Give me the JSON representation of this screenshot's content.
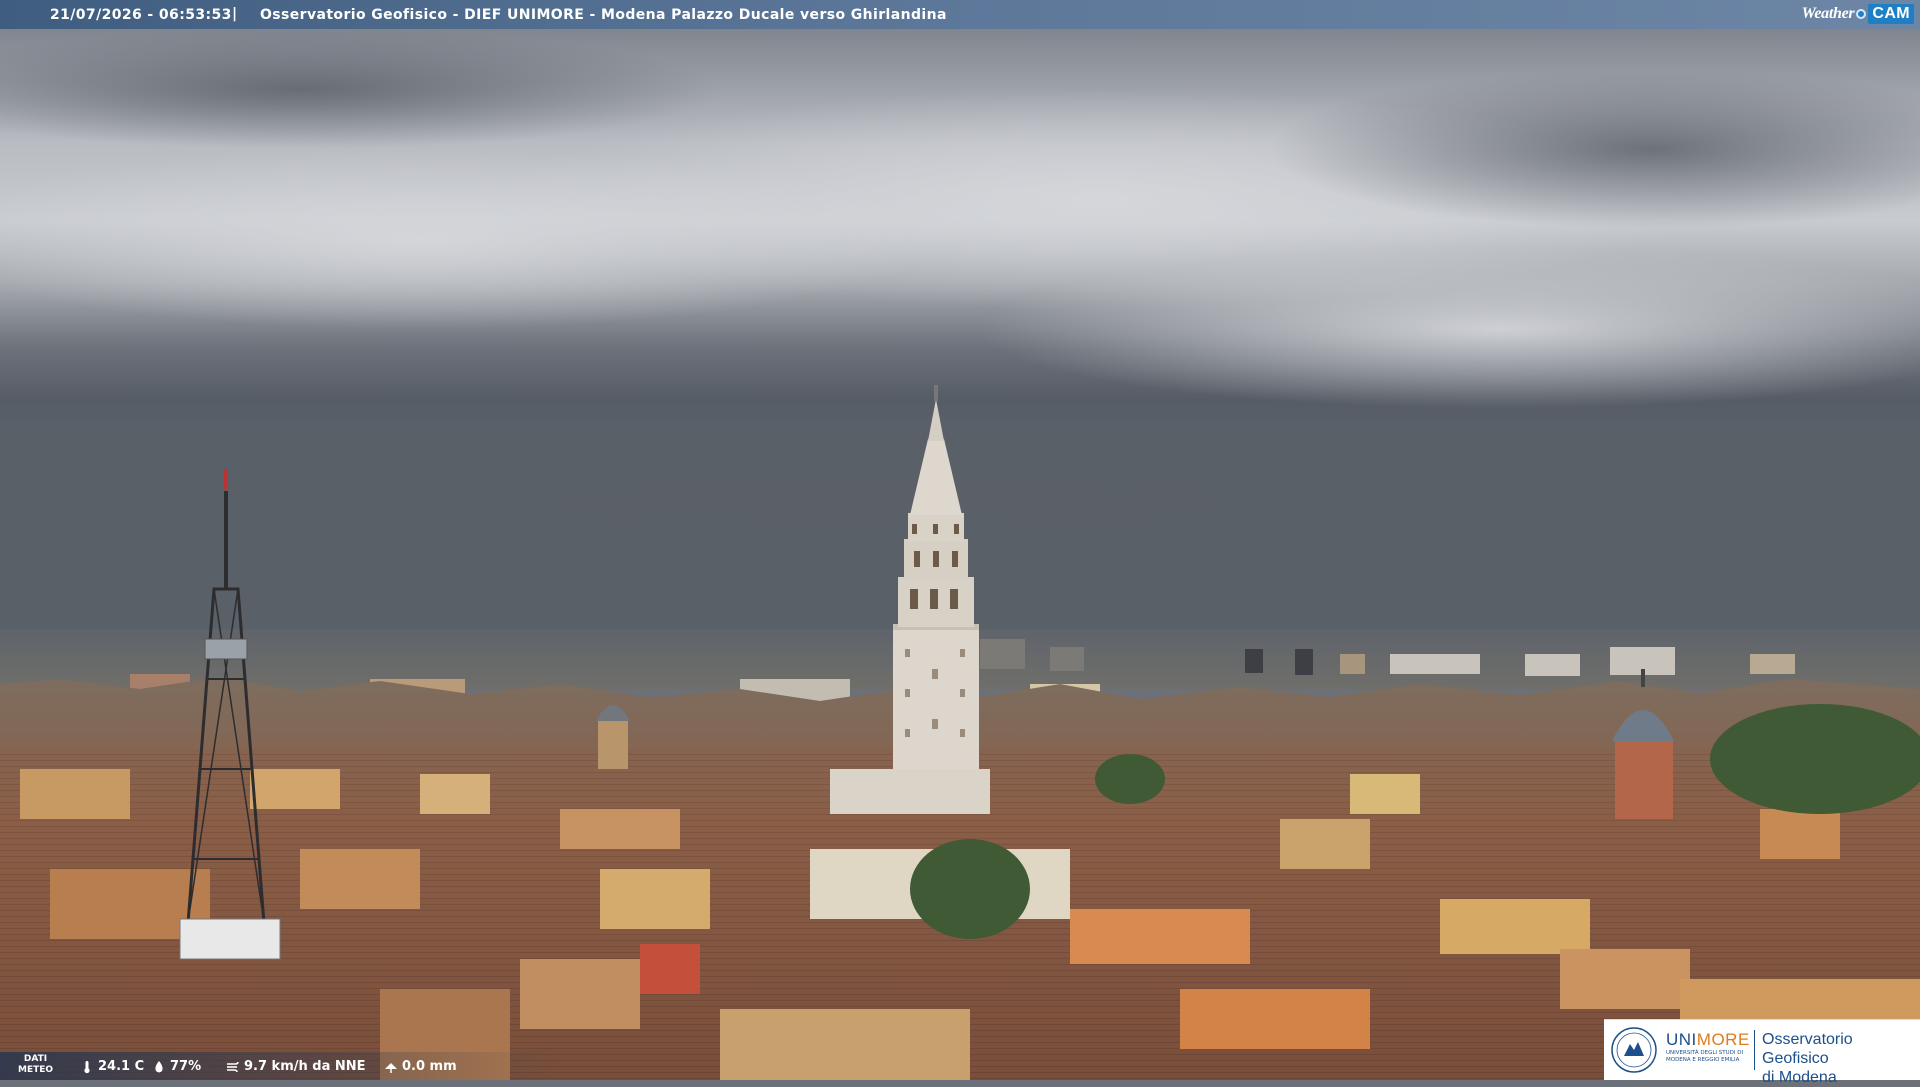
{
  "overlay": {
    "timestamp": "21/07/2026 - 06:53:53",
    "separator": "|",
    "location": "Osservatorio Geofisico - DIEF UNIMORE - Modena Palazzo Ducale verso Ghirlandina",
    "brand_weather": "Weather",
    "brand_cam": "CAM"
  },
  "meteo": {
    "label_line1": "DATI",
    "label_line2": "METEO",
    "temperature": "24.1 C",
    "humidity": "77%",
    "wind": "9.7 km/h da NNE",
    "rain": "0.0 mm"
  },
  "logo": {
    "uni_part1": "UNI",
    "uni_part2": "MORE",
    "uni_sub": "UNIVERSITÀ DEGLI STUDI DI MODENA E REGGIO EMILIA",
    "observatory_line1": "Osservatorio Geofisico",
    "observatory_line2": "di Modena"
  },
  "colors": {
    "sky_top": "#7e838c",
    "sky_mid": "#c9ccd1",
    "sky_low": "#4e545d",
    "roof": "#8a5a42",
    "tower": "#dcd6cc"
  }
}
